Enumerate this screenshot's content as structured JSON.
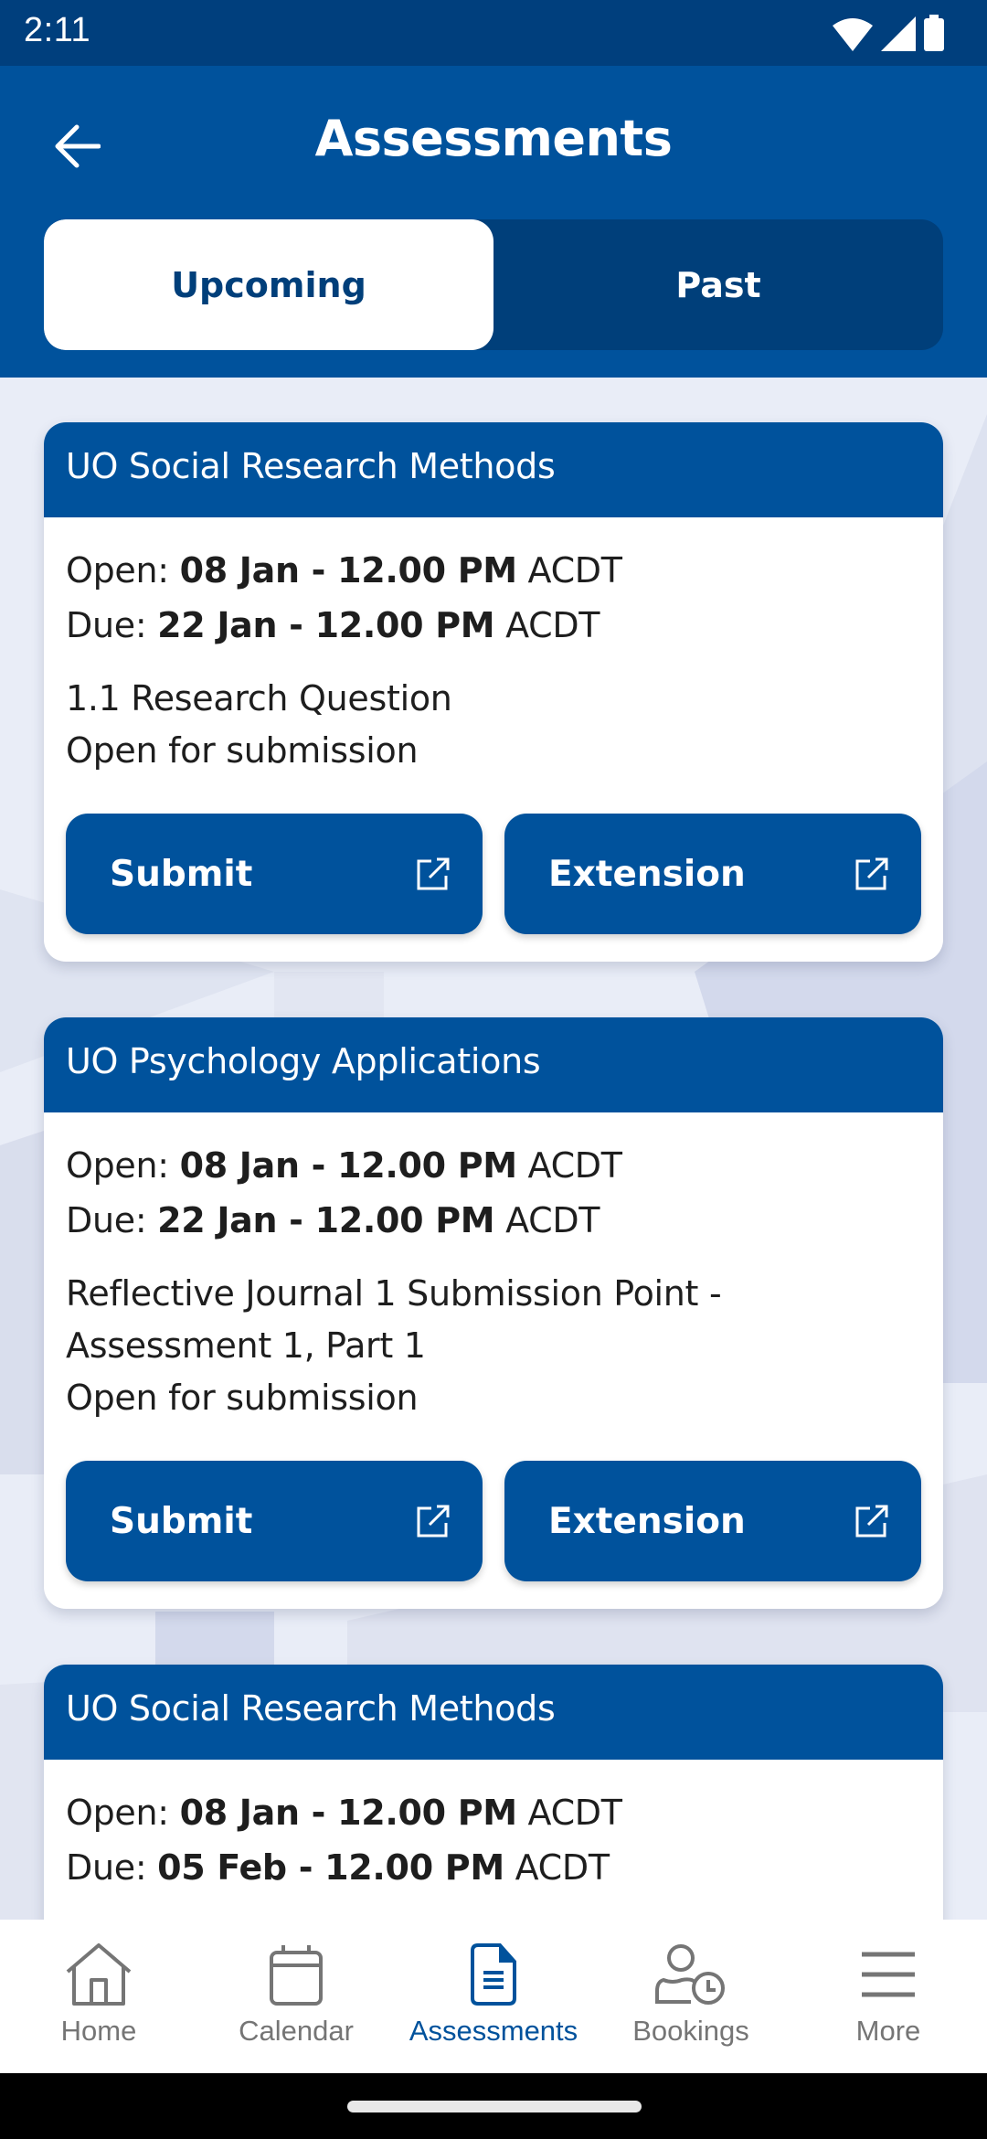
{
  "status_bar": {
    "time": "2:11",
    "icons": [
      "wifi-icon",
      "signal-icon",
      "battery-icon"
    ]
  },
  "app_bar": {
    "title": "Assessments",
    "back_icon": "arrow-left-icon"
  },
  "tabs": [
    {
      "label": "Upcoming",
      "active": true
    },
    {
      "label": "Past",
      "active": false
    }
  ],
  "colors": {
    "primary": "#00529c",
    "dark": "#003f7a",
    "background": "#e9edf7",
    "inactive": "#757575"
  },
  "assessments": [
    {
      "course": "UO Social Research Methods",
      "open_label": "Open:",
      "open_value": "08 Jan - 12.00 PM",
      "open_tz": "ACDT",
      "due_label": "Due:",
      "due_value": "22 Jan - 12.00 PM",
      "due_tz": "ACDT",
      "title": "1.1 Research Question",
      "status": "Open for submission",
      "submit_label": "Submit",
      "extension_label": "Extension"
    },
    {
      "course": "UO Psychology Applications",
      "open_label": "Open:",
      "open_value": "08 Jan - 12.00 PM",
      "open_tz": "ACDT",
      "due_label": "Due:",
      "due_value": "22 Jan - 12.00 PM",
      "due_tz": "ACDT",
      "title": "Reflective Journal 1 Submission Point - Assessment 1, Part 1",
      "status": "Open for submission",
      "submit_label": "Submit",
      "extension_label": "Extension"
    },
    {
      "course": "UO Social Research Methods",
      "open_label": "Open:",
      "open_value": "08 Jan - 12.00 PM",
      "open_tz": "ACDT",
      "due_label": "Due:",
      "due_value": "05 Feb - 12.00 PM",
      "due_tz": "ACDT"
    }
  ],
  "bottom_nav": [
    {
      "label": "Home",
      "icon": "home-icon",
      "active": false
    },
    {
      "label": "Calendar",
      "icon": "calendar-icon",
      "active": false
    },
    {
      "label": "Assessments",
      "icon": "document-icon",
      "active": true
    },
    {
      "label": "Bookings",
      "icon": "person-clock-icon",
      "active": false
    },
    {
      "label": "More",
      "icon": "menu-icon",
      "active": false
    }
  ]
}
